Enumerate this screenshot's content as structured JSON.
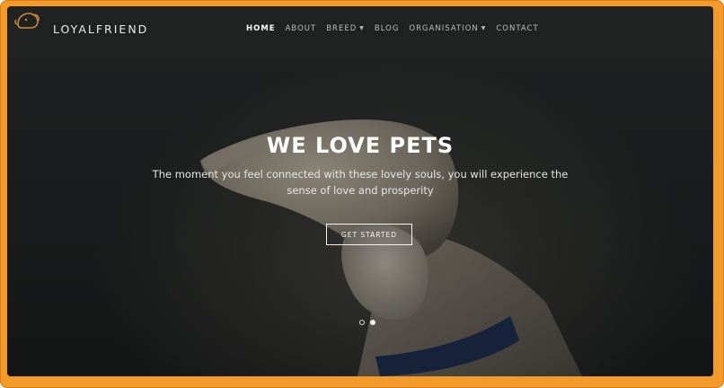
{
  "brand": {
    "name": "LOYALFRIEND",
    "logo_icon": "dog-icon"
  },
  "nav": {
    "items": [
      {
        "label": "HOME",
        "active": true
      },
      {
        "label": "ABOUT",
        "active": false
      },
      {
        "label": "BREED",
        "active": false,
        "dropdown": true
      },
      {
        "label": "BLOG",
        "active": false
      },
      {
        "label": "ORGANISATION",
        "active": false,
        "dropdown": true
      },
      {
        "label": "CONTACT",
        "active": false
      }
    ]
  },
  "hero": {
    "title": "WE LOVE PETS",
    "subtitle": "The moment you feel connected with these lovely souls, you will experience the sense of love and prosperity",
    "cta_label": "GET STARTED"
  },
  "carousel": {
    "slides": 2,
    "active_index": 1
  },
  "colors": {
    "frame": "#f39a2b",
    "background": "#1c1f1f",
    "text": "#ffffff"
  }
}
